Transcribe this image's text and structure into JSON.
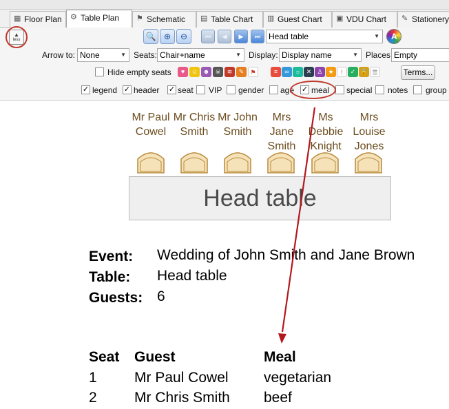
{
  "tabs": [
    {
      "label": "Floor Plan",
      "icon": "grid-icon"
    },
    {
      "label": "Table Plan",
      "icon": "gear-icon"
    },
    {
      "label": "Schematic",
      "icon": "schematic-icon"
    },
    {
      "label": "Table Chart",
      "icon": "table-chart-icon"
    },
    {
      "label": "Guest Chart",
      "icon": "guest-chart-icon"
    },
    {
      "label": "VDU Chart",
      "icon": "monitor-icon"
    },
    {
      "label": "Stationery",
      "icon": "pencil-icon"
    }
  ],
  "toolbar": {
    "less_label": "less",
    "table_select": "Head table",
    "arrow_to_label": "Arrow to:",
    "arrow_to_value": "None",
    "seats_label": "Seats:",
    "seats_value": "Chair+name",
    "display_label": "Display:",
    "display_value": "Display name",
    "places_label": "Places:",
    "places_value": "Empty",
    "hide_empty_seats": "Hide empty seats",
    "terms_label": "Terms..."
  },
  "options": [
    {
      "label": "legend",
      "checked": true
    },
    {
      "label": "header",
      "checked": true
    },
    {
      "label": "seat",
      "checked": true
    },
    {
      "label": "VIP",
      "checked": false
    },
    {
      "label": "gender",
      "checked": false
    },
    {
      "label": "age",
      "checked": false
    },
    {
      "label": "meal",
      "checked": true
    },
    {
      "label": "special",
      "checked": false
    },
    {
      "label": "notes",
      "checked": false
    },
    {
      "label": "group",
      "checked": false
    }
  ],
  "guests_on_plan": [
    [
      "Mr Paul",
      "Cowel"
    ],
    [
      "Mr Chris",
      "Smith"
    ],
    [
      "Mr John",
      "Smith"
    ],
    [
      "Mrs",
      "Jane",
      "Smith"
    ],
    [
      "Ms",
      "Debbie",
      "Knight"
    ],
    [
      "Mrs",
      "Louise",
      "Jones"
    ]
  ],
  "table_name": "Head table",
  "info": {
    "event_key": "Event:",
    "event_value": "Wedding of John Smith and Jane Brown",
    "table_key": "Table:",
    "table_value": "Head table",
    "guests_key": "Guests:",
    "guests_value": "6"
  },
  "legend_table": {
    "headers": [
      "Seat",
      "Guest",
      "Meal"
    ],
    "rows": [
      [
        "1",
        "Mr Paul Cowel",
        "vegetarian"
      ],
      [
        "2",
        "Mr Chris Smith",
        "beef"
      ]
    ]
  },
  "colors": {
    "annotation_red": "#b3181e",
    "guest_name": "#6b4d1f",
    "chair_fill": "#f5e2b8",
    "chair_stroke": "#b8893a"
  }
}
